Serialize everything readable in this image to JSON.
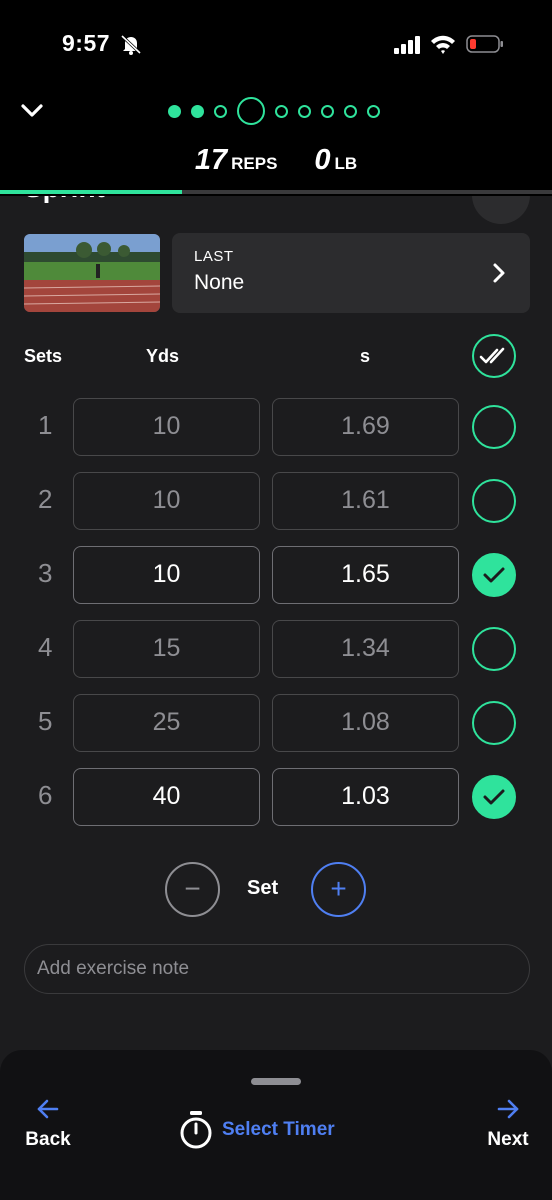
{
  "status_bar": {
    "time": "9:57",
    "icons": [
      "bell-slash-icon",
      "signal-icon",
      "wifi-icon",
      "battery-low-icon"
    ]
  },
  "header": {
    "collapse_icon": "chevron-down-icon",
    "exercise_dots": {
      "total": 9,
      "completed": 2,
      "current_index": 3
    },
    "reps_value": "17",
    "reps_unit": "REPS",
    "weight_value": "0",
    "weight_unit": "LB",
    "progress_fraction": 0.33
  },
  "exercise": {
    "title": "Sprint",
    "last_label": "LAST",
    "last_value": "None"
  },
  "table": {
    "headers": {
      "sets": "Sets",
      "yds": "Yds",
      "s": "s"
    },
    "rows": [
      {
        "set": "1",
        "yds": "10",
        "s": "1.69",
        "done": false
      },
      {
        "set": "2",
        "yds": "10",
        "s": "1.61",
        "done": false
      },
      {
        "set": "3",
        "yds": "10",
        "s": "1.65",
        "done": true
      },
      {
        "set": "4",
        "yds": "15",
        "s": "1.34",
        "done": false
      },
      {
        "set": "5",
        "yds": "25",
        "s": "1.08",
        "done": false
      },
      {
        "set": "6",
        "yds": "40",
        "s": "1.03",
        "done": true
      }
    ]
  },
  "set_controls": {
    "minus": "−",
    "label": "Set",
    "plus": "+"
  },
  "note": {
    "placeholder": "Add exercise note"
  },
  "bottom_bar": {
    "back_label": "Back",
    "next_label": "Next",
    "timer_label": "Select Timer"
  },
  "colors": {
    "accent_green": "#2fe39c",
    "accent_blue": "#4f7ff2",
    "background": "#1c1c1e"
  }
}
